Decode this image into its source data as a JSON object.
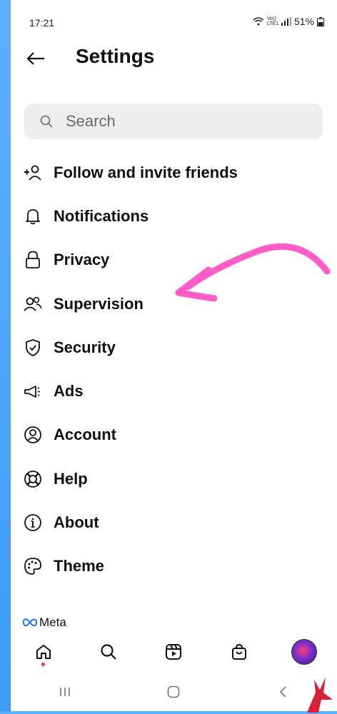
{
  "status": {
    "time": "17:21",
    "battery": "51%",
    "network": "Vo)) LTE1"
  },
  "header": {
    "title": "Settings",
    "back_icon": "arrow-left-icon"
  },
  "search": {
    "placeholder": "Search"
  },
  "menu": [
    {
      "label": "Follow and invite friends",
      "icon": "add-person-icon"
    },
    {
      "label": "Notifications",
      "icon": "bell-icon"
    },
    {
      "label": "Privacy",
      "icon": "lock-icon"
    },
    {
      "label": "Supervision",
      "icon": "people-icon"
    },
    {
      "label": "Security",
      "icon": "shield-check-icon"
    },
    {
      "label": "Ads",
      "icon": "megaphone-icon"
    },
    {
      "label": "Account",
      "icon": "account-circle-icon"
    },
    {
      "label": "Help",
      "icon": "lifebuoy-icon"
    },
    {
      "label": "About",
      "icon": "info-icon"
    },
    {
      "label": "Theme",
      "icon": "palette-icon"
    }
  ],
  "footer": {
    "brand": "Meta"
  },
  "colors": {
    "annotation_arrow": "#ff5cc8",
    "background": "#4aa6ff",
    "notification_dot": "#ff3040"
  }
}
